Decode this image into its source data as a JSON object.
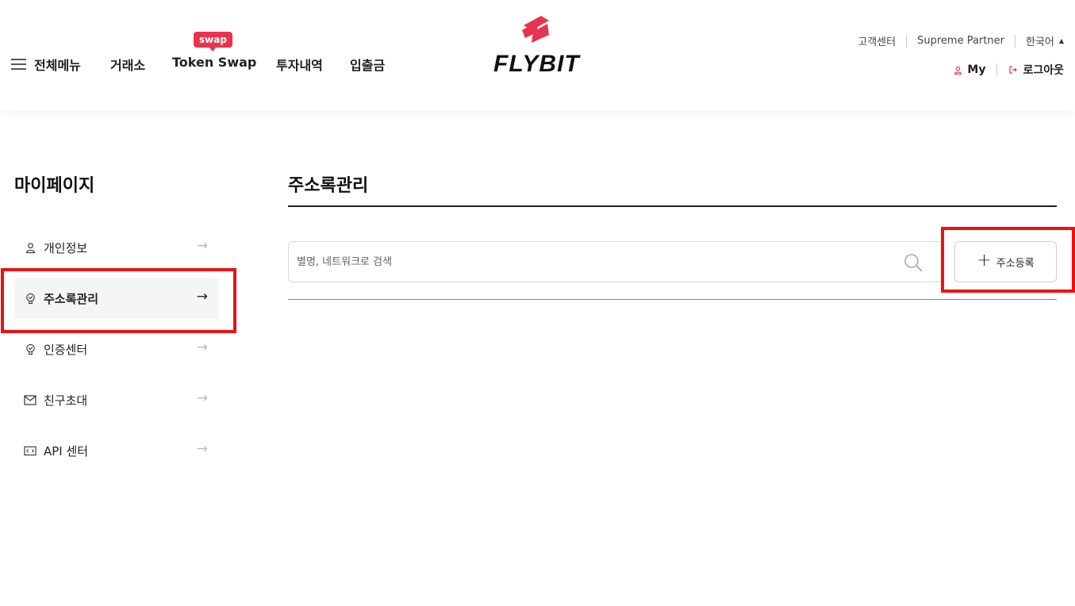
{
  "header": {
    "menu_label": "전체메뉴",
    "nav": [
      "거래소",
      "Token Swap",
      "투자내역",
      "입출금"
    ],
    "swap_badge": "swap",
    "logo_text": "FLYBIT",
    "util_links": [
      "고객센터",
      "Supreme Partner"
    ],
    "language": "한국어",
    "my_label": "My",
    "logout_label": "로그아웃",
    "accent_color": "#e8344e"
  },
  "sidebar": {
    "title": "마이페이지",
    "items": [
      {
        "label": "개인정보",
        "icon": "user-icon",
        "active": false
      },
      {
        "label": "주소록관리",
        "icon": "bulb-icon",
        "active": true
      },
      {
        "label": "인증센터",
        "icon": "bulb-icon",
        "active": false
      },
      {
        "label": "친구초대",
        "icon": "mail-icon",
        "active": false
      },
      {
        "label": "API 센터",
        "icon": "api-icon",
        "active": false
      }
    ]
  },
  "main": {
    "title": "주소록관리",
    "search_placeholder": "별명, 네트워크로 검색",
    "add_button_label": "주소등록"
  },
  "highlight_color": "#ee1111"
}
